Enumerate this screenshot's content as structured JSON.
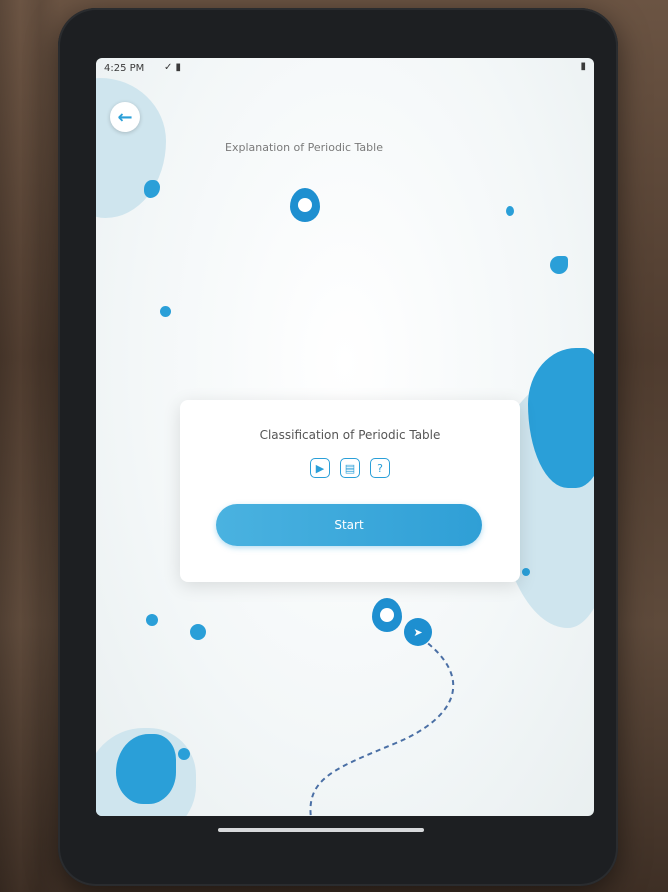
{
  "status": {
    "time": "4:25 PM",
    "icons": "✓ ▮",
    "right": "▮"
  },
  "header": {
    "back_icon": "arrow-left-icon",
    "back_glyph": "←",
    "previous_lesson_title": "Explanation of Periodic Table"
  },
  "card": {
    "title": "Classification of Periodic Table",
    "icons": [
      {
        "name": "video-icon",
        "glyph": "▶"
      },
      {
        "name": "document-icon",
        "glyph": "▤"
      },
      {
        "name": "quiz-icon",
        "glyph": "?"
      }
    ],
    "start_label": "Start"
  },
  "colors": {
    "accent": "#2a9fd8",
    "blob_light": "#cfe5ee"
  }
}
